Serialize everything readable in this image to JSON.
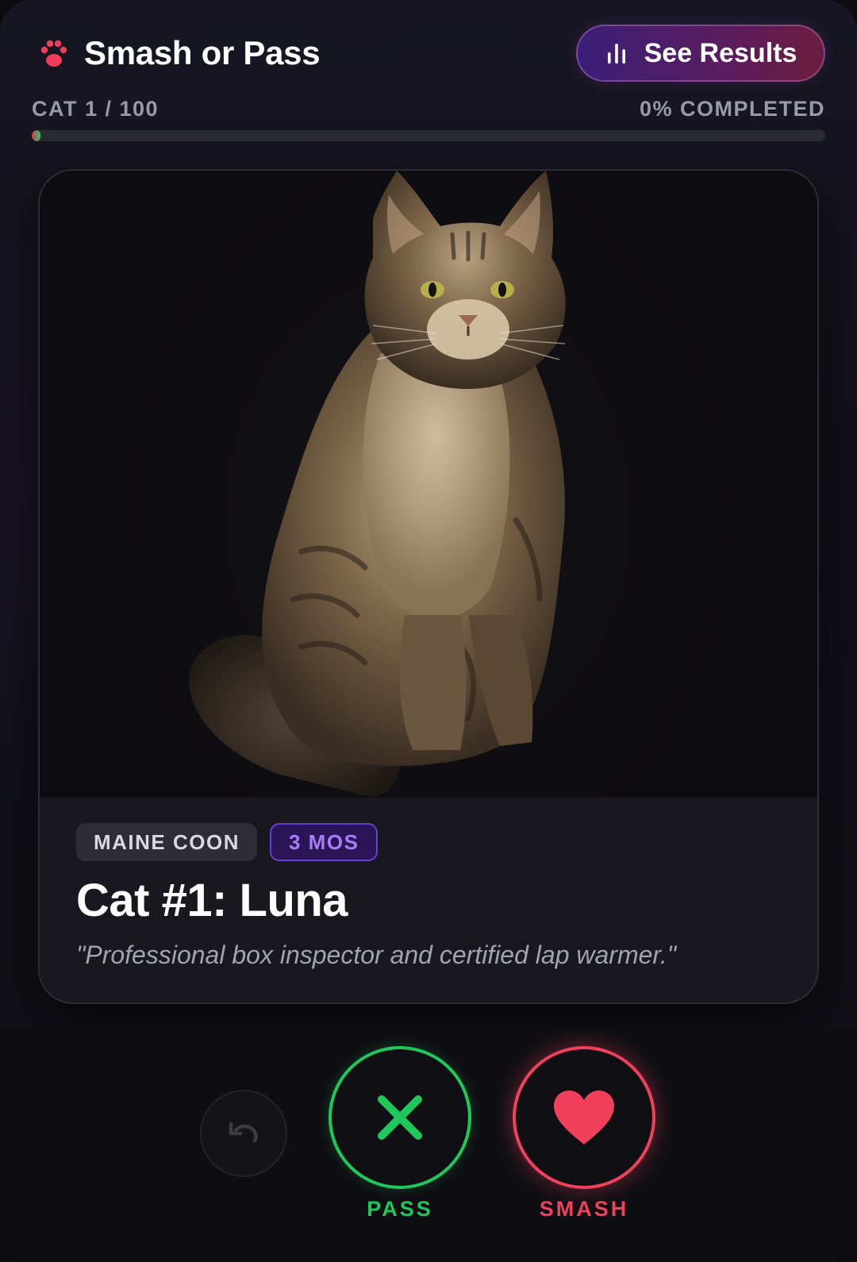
{
  "app": {
    "title": "Smash or Pass",
    "logo_icon": "paw-icon",
    "results_button": {
      "label": "See Results",
      "icon": "bar-chart-icon"
    }
  },
  "progress": {
    "counter": "CAT 1 / 100",
    "percent_label": "0% COMPLETED",
    "fraction": 0.0
  },
  "cat": {
    "breed": "MAINE COON",
    "age": "3 MOS",
    "name": "Cat #1: Luna",
    "tagline": "\"Professional box inspector and certified lap warmer.\""
  },
  "controls": {
    "undo_icon": "undo-icon",
    "pass": {
      "label": "PASS",
      "icon": "x-icon",
      "color": "#1fc85b"
    },
    "smash": {
      "label": "SMASH",
      "icon": "heart-icon",
      "color": "#f0405c"
    }
  },
  "colors": {
    "accent_red": "#f0405c",
    "accent_green": "#1fc85b",
    "accent_purple": "#6a3fd6"
  }
}
